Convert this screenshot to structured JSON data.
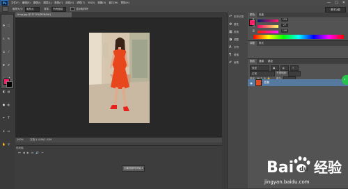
{
  "menubar": {
    "logo": "Ps",
    "items": [
      "文件(F)",
      "编辑(E)",
      "图像(I)",
      "图层(L)",
      "类型(Y)",
      "选择(S)",
      "滤镜(T)",
      "3D(D)",
      "视图(V)",
      "窗口(W)",
      "帮助(H)"
    ],
    "window_buttons": [
      "—",
      "□",
      "✕"
    ]
  },
  "options_bar": {
    "tool_icon": "quick-selection-icon",
    "items": [
      "取样大小:",
      "取样点",
      "样本:",
      "所有图层",
      "显示取样环"
    ],
    "workspace": "基本功能"
  },
  "toolbar": {
    "tools": [
      "move-icon",
      "marquee-icon",
      "lasso-icon",
      "quick-select-icon",
      "crop-icon",
      "eyedropper-icon",
      "healing-icon",
      "brush-icon",
      "stamp-icon",
      "history-brush-icon",
      "eraser-icon",
      "gradient-icon",
      "blur-icon",
      "dodge-icon",
      "pen-icon",
      "type-icon",
      "path-select-icon",
      "shape-icon",
      "hand-icon",
      "zoom-icon"
    ],
    "foreground_color": "#ff1b6a",
    "background_color": "#000000"
  },
  "document": {
    "tab": "timg.jpg @ 37.5%(RGB/8#)",
    "status": "100%",
    "status_doc": "文档:1.41M/1.41M"
  },
  "timeline": {
    "header": "时间轴",
    "create_button": "创建视频时间轴"
  },
  "panel_strip": {
    "items": [
      {
        "icon": "history-icon",
        "label": "历史记录"
      },
      {
        "icon": "properties-icon",
        "label": "属性"
      },
      {
        "icon": "swatches-icon",
        "label": "色板"
      },
      {
        "icon": "adjust-icon",
        "label": "调整"
      },
      {
        "icon": "character-icon",
        "label": "字符"
      },
      {
        "icon": "paragraph-icon",
        "label": "段落"
      },
      {
        "icon": "brush-preset-icon",
        "label": "画笔"
      }
    ]
  },
  "color_panel": {
    "tabs": [
      "颜色",
      "色板"
    ],
    "sliders": [
      {
        "label": "R",
        "value": "255"
      },
      {
        "label": "G",
        "value": "27"
      },
      {
        "label": "B",
        "value": "106"
      }
    ],
    "color": "#ff1b6a"
  },
  "adjust_panel": {
    "tabs": [
      "调整",
      "样式"
    ]
  },
  "layers_panel": {
    "tabs": [
      "图层",
      "通道",
      "路径"
    ],
    "kind": "类型",
    "blend": "正常",
    "opacity_label": "不透明度:",
    "lock_label": "锁定:",
    "fill_label": "填充:",
    "layer_name": "背景"
  },
  "watermark": {
    "brand": "Baidu",
    "brand_cn": "经验",
    "url": "jingyan.baidu.com"
  }
}
